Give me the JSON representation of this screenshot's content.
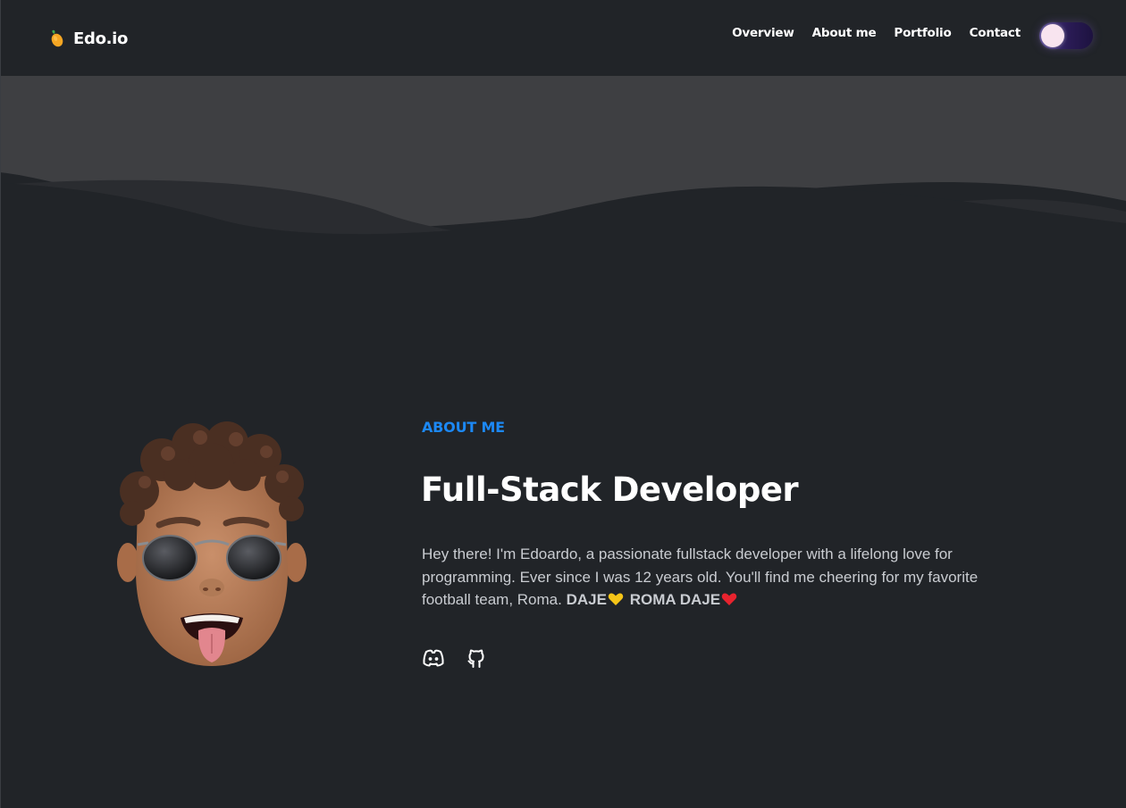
{
  "navbar": {
    "brand": "Edo.io",
    "links": [
      "Overview",
      "About me",
      "Portfolio",
      "Contact"
    ]
  },
  "about": {
    "label": "ABOUT ME",
    "title": "Full-Stack Developer",
    "bio_text": "Hey there! I'm Edoardo, a passionate fullstack developer with a lifelong love for programming. Ever since I was 12 years old. You'll find me cheering for my favorite football team, Roma.",
    "bio_strong_1": "DAJE",
    "bio_strong_2": "ROMA DAJE",
    "socials": [
      "discord-icon",
      "github-icon"
    ]
  },
  "colors": {
    "background": "#212428",
    "accent": "#1c88f4",
    "wave_light": "#3e3f42",
    "wave_mid": "#2f3134",
    "text_muted": "#c9ccd1"
  }
}
